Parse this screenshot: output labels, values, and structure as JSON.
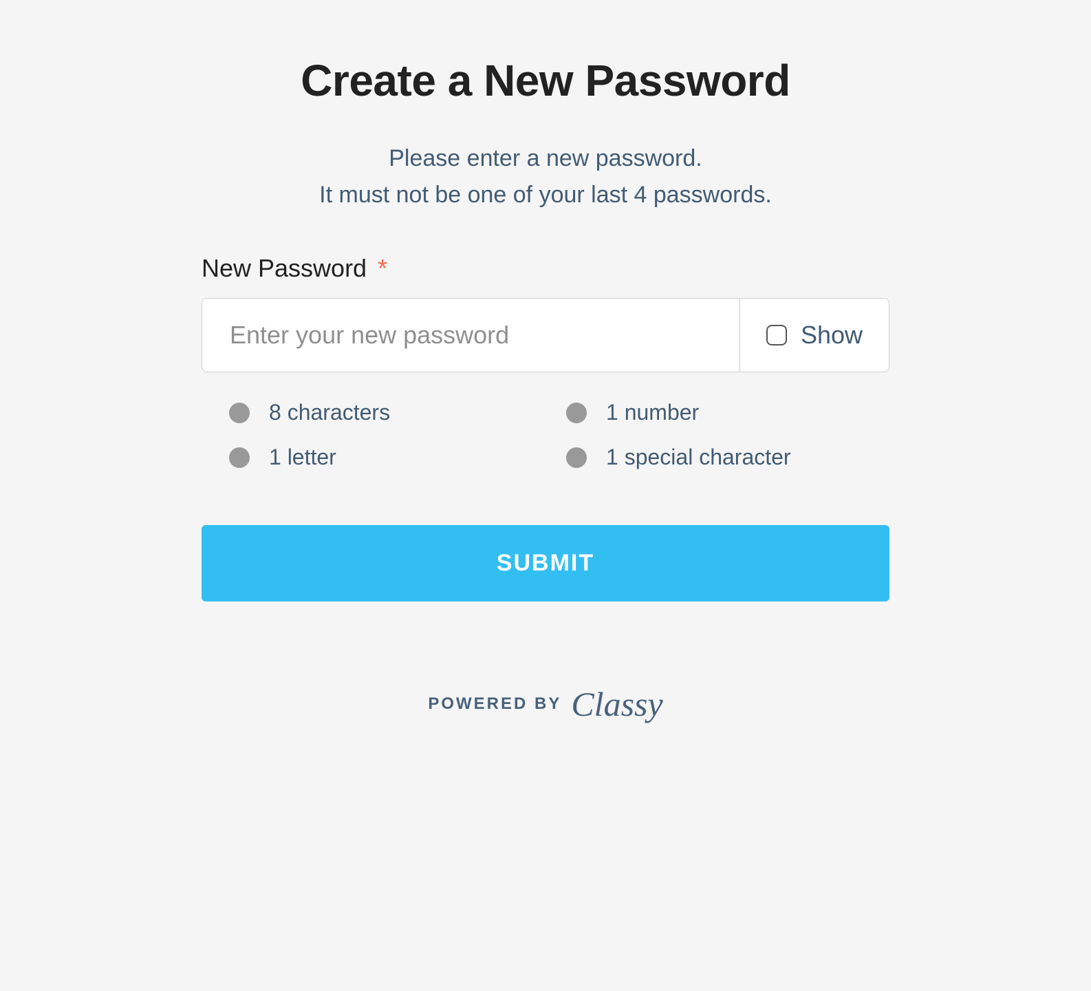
{
  "title": "Create a New Password",
  "instructions": {
    "line1": "Please enter a new password.",
    "line2": "It must not be one of your last 4 passwords."
  },
  "field": {
    "label": "New Password",
    "required_marker": "*",
    "placeholder": "Enter your new password",
    "value": "",
    "show_label": "Show"
  },
  "requirements": [
    "8 characters",
    "1 number",
    "1 letter",
    "1 special character"
  ],
  "submit_label": "SUBMIT",
  "footer": {
    "powered_by": "POWERED BY",
    "brand": "Classy"
  }
}
